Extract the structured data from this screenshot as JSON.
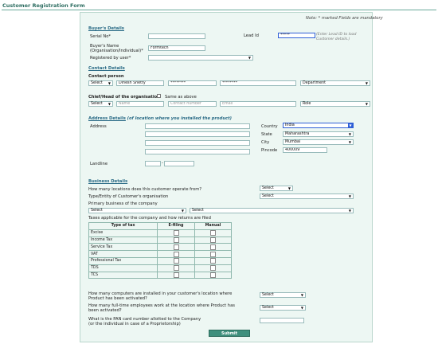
{
  "page_title": "Customer Registration Form",
  "note": "Note:  * marked Fields are mandatory",
  "buyer": {
    "heading": "Buyer's Details",
    "serial_label": "Serial No*",
    "lead_label": "Lead Id",
    "lead_value": "*****",
    "lead_hint_1": "(Enter Lead ID to load",
    "lead_hint_2": "Customer details.)",
    "name_label_1": "Buyer's Name",
    "name_label_2": "(Organisation/Individual)*",
    "name_value": "Formtech",
    "registered_label": "Registered by user*"
  },
  "contact": {
    "heading": "Contact Details",
    "person_label": "Contact person",
    "title_select": "Select",
    "person_name": "Dinesh Shetty",
    "person_mobile": "********",
    "person_email": "********",
    "person_role": "Department",
    "chief_label": "Chief/Head of the organisation",
    "same_label": "Same as above",
    "chief_title": "Select",
    "chief_name_ph": "Name",
    "chief_number_ph": "Contact number",
    "chief_email_ph": "Email",
    "chief_role": "Role"
  },
  "address": {
    "heading": "Address Details",
    "heading_note": "(of location where you installed the product)",
    "address_label": "Address",
    "landline_label": "Landline",
    "landline_sep": "-",
    "country_label": "Country",
    "country_value": "India",
    "state_label": "State",
    "state_value": "Maharashtra",
    "city_label": "City",
    "city_value": "Mumbai",
    "pincode_label": "Pincode",
    "pincode_value": "400009"
  },
  "business": {
    "heading": "Business Details",
    "locations_q": "How many locations does this customer operate from?",
    "locations_value": "Select",
    "type_q": "Type/Entity of Customer's organisation",
    "type_value": "Select",
    "primary_label": "Primary business of the company",
    "primary_value_1": "Select",
    "primary_value_2": "Select",
    "taxes_label": "Taxes applicable for the company and how returns are filed",
    "tax_headers": [
      "Type of tax",
      "E-filing",
      "Manual"
    ],
    "tax_rows": [
      "Excise",
      "Income Tax",
      "Service Tax",
      "VAT",
      "Professional Tax",
      "TDS",
      "TCS"
    ],
    "computers_q_1": "How many computers are installed in your customer's location where",
    "computers_q_2": "Product has been activated?",
    "computers_value": "Select",
    "employees_q_1": "How many full-time employees work at the location where Product has",
    "employees_q_2": "been activated?",
    "employees_value": "Select",
    "pan_q_1": "What is the PAN card number allotted to the Company",
    "pan_q_2": "(or the individual in case of a Proprietorship)"
  },
  "submit_label": "Submit"
}
